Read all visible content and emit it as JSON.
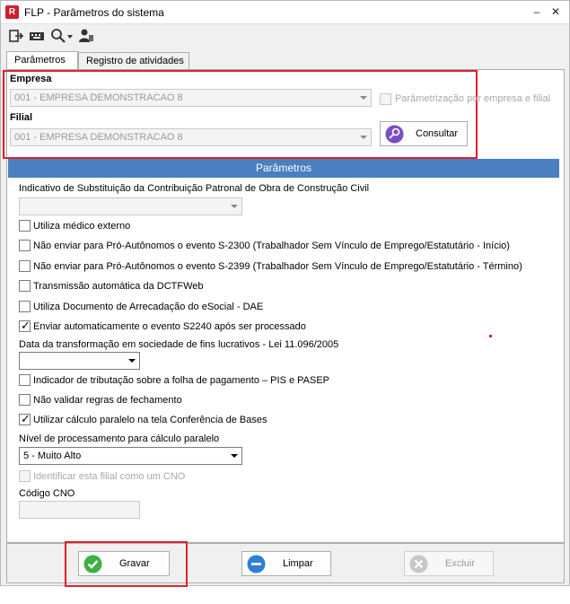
{
  "window": {
    "title": "FLP - Parâmetros do sistema",
    "app_icon_letter": "R"
  },
  "tabs": [
    {
      "label": "Parâmetros",
      "active": true
    },
    {
      "label": "Registro de atividades",
      "active": false
    }
  ],
  "empresa": {
    "label": "Empresa",
    "value": "001 - EMPRESA DEMONSTRACAO 8"
  },
  "filial": {
    "label": "Filial",
    "value": "001 - EMPRESA DEMONSTRACAO 8"
  },
  "param_por_empresa": {
    "label": "Parâmetrização por empresa e filial",
    "checked": false
  },
  "consultar_button": "Consultar",
  "section_title": "Parâmetros",
  "params": {
    "substituicao_label": "Indicativo de Substituição da Contribuição Patronal de Obra de Construção Civil",
    "substituicao_value": "",
    "medico_externo": "Utiliza médico externo",
    "nao_enviar_s2300": "Não enviar para Pró-Autônomos o evento S-2300 (Trabalhador Sem Vínculo de Emprego/Estatutário - Início)",
    "nao_enviar_s2399": "Não enviar para Pró-Autônomos o evento S-2399 (Trabalhador Sem Vínculo de Emprego/Estatutário - Término)",
    "dctfweb": "Transmissão automática da DCTFWeb",
    "dae": "Utiliza Documento de Arrecadação do eSocial - DAE",
    "s2240": "Enviar automaticamente o evento S2240 após ser processado",
    "data_transformacao_label": "Data da transformação em sociedade de fins lucrativos - Lei 11.096/2005",
    "data_transformacao_value": "",
    "pis_pasep": "Indicador de tributação sobre a folha de pagamento – PIS e PASEP",
    "nao_validar": "Não validar regras de fechamento",
    "calculo_paralelo": "Utilizar cálculo paralelo na tela Conferência de Bases",
    "nivel_label": "Nível de processamento para cálculo paralelo",
    "nivel_value": "5 - Muito Alto",
    "cno_checkbox": "Identificar esta filial como um CNO",
    "codigo_cno_label": "Código CNO",
    "codigo_cno_value": ""
  },
  "checked_states": {
    "medico_externo": false,
    "nao_enviar_s2300": false,
    "nao_enviar_s2399": false,
    "dctfweb": false,
    "dae": false,
    "s2240": true,
    "pis_pasep": false,
    "nao_validar": false,
    "calculo_paralelo": true,
    "cno_checkbox": false
  },
  "buttons": {
    "gravar": "Gravar",
    "limpar": "Limpar",
    "excluir": "Excluir"
  },
  "colors": {
    "highlight_red": "#e0202a",
    "section_blue": "#4a7fc0"
  }
}
